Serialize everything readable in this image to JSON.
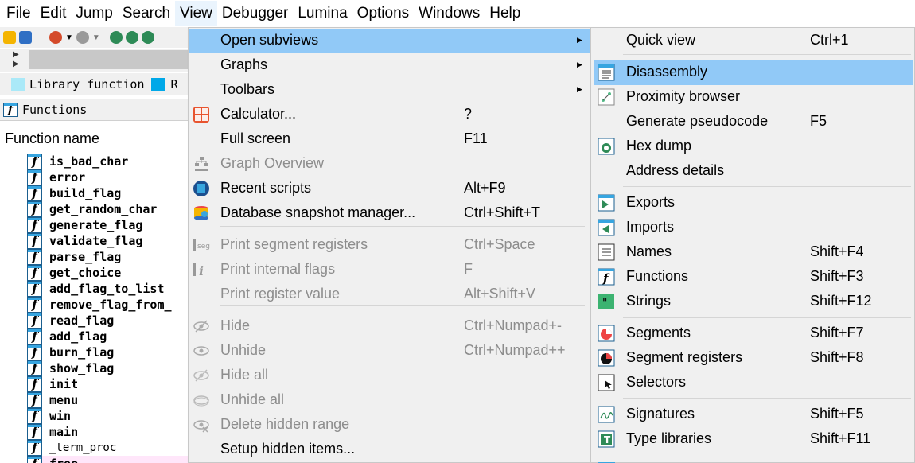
{
  "menubar": {
    "items": [
      "File",
      "Edit",
      "Jump",
      "Search",
      "View",
      "Debugger",
      "Lumina",
      "Options",
      "Windows",
      "Help"
    ],
    "active": "View"
  },
  "legend": {
    "library_function": "Library function",
    "truncated": "R"
  },
  "functions_window": {
    "title": "Functions",
    "column_header": "Function name",
    "items": [
      "is_bad_char",
      "error",
      "build_flag",
      "get_random_char",
      "generate_flag",
      "validate_flag",
      "parse_flag",
      "get_choice",
      "add_flag_to_list",
      "remove_flag_from_",
      "read_flag",
      "add_flag",
      "burn_flag",
      "show_flag",
      "init",
      "menu",
      "win",
      "main",
      "_term_proc",
      "free"
    ]
  },
  "view_menu": {
    "items": [
      {
        "label": "Open subviews",
        "shortcut": "",
        "submenu": true,
        "disabled": false,
        "selected": true,
        "icon": ""
      },
      {
        "label": "Graphs",
        "shortcut": "",
        "submenu": true,
        "disabled": false,
        "icon": ""
      },
      {
        "label": "Toolbars",
        "shortcut": "",
        "submenu": true,
        "disabled": false,
        "icon": ""
      },
      {
        "label": "Calculator...",
        "shortcut": "?",
        "disabled": false,
        "icon": "calculator-icon"
      },
      {
        "label": "Full screen",
        "shortcut": "F11",
        "disabled": false,
        "icon": ""
      },
      {
        "label": "Graph Overview",
        "shortcut": "",
        "disabled": true,
        "icon": "graph-overview-icon"
      },
      {
        "label": "Recent scripts",
        "shortcut": "Alt+F9",
        "disabled": false,
        "icon": "recent-scripts-icon"
      },
      {
        "label": "Database snapshot manager...",
        "shortcut": "Ctrl+Shift+T",
        "disabled": false,
        "icon": "database-snapshot-icon"
      },
      {
        "label": "Print segment registers",
        "shortcut": "Ctrl+Space",
        "disabled": true,
        "icon": "segment-registers-icon"
      },
      {
        "label": "Print internal flags",
        "shortcut": "F",
        "disabled": true,
        "icon": "internal-flags-icon"
      },
      {
        "label": "Print register value",
        "shortcut": "Alt+Shift+V",
        "disabled": true,
        "icon": ""
      },
      {
        "label": "Hide",
        "shortcut": "Ctrl+Numpad+-",
        "disabled": true,
        "icon": "hide-icon"
      },
      {
        "label": "Unhide",
        "shortcut": "Ctrl+Numpad++",
        "disabled": true,
        "icon": "unhide-icon"
      },
      {
        "label": "Hide all",
        "shortcut": "",
        "disabled": true,
        "icon": "hide-all-icon"
      },
      {
        "label": "Unhide all",
        "shortcut": "",
        "disabled": true,
        "icon": "unhide-all-icon"
      },
      {
        "label": "Delete hidden range",
        "shortcut": "",
        "disabled": true,
        "icon": "delete-hidden-range-icon"
      },
      {
        "label": "Setup hidden items...",
        "shortcut": "",
        "disabled": false,
        "icon": ""
      }
    ]
  },
  "subviews_menu": {
    "items": [
      {
        "label": "Quick view",
        "shortcut": "Ctrl+1",
        "icon": ""
      },
      {
        "label": "Disassembly",
        "shortcut": "",
        "icon": "disassembly-icon",
        "selected": true
      },
      {
        "label": "Proximity browser",
        "shortcut": "",
        "icon": "proximity-browser-icon"
      },
      {
        "label": "Generate pseudocode",
        "shortcut": "F5",
        "icon": ""
      },
      {
        "label": "Hex dump",
        "shortcut": "",
        "icon": "hex-dump-icon"
      },
      {
        "label": "Address details",
        "shortcut": "",
        "icon": ""
      },
      {
        "label": "Exports",
        "shortcut": "",
        "icon": "exports-icon"
      },
      {
        "label": "Imports",
        "shortcut": "",
        "icon": "imports-icon"
      },
      {
        "label": "Names",
        "shortcut": "Shift+F4",
        "icon": "names-icon"
      },
      {
        "label": "Functions",
        "shortcut": "Shift+F3",
        "icon": "functions-icon"
      },
      {
        "label": "Strings",
        "shortcut": "Shift+F12",
        "icon": "strings-icon"
      },
      {
        "label": "Segments",
        "shortcut": "Shift+F7",
        "icon": "segments-icon"
      },
      {
        "label": "Segment registers",
        "shortcut": "Shift+F8",
        "icon": "segment-registers-view-icon"
      },
      {
        "label": "Selectors",
        "shortcut": "",
        "icon": "selectors-icon"
      },
      {
        "label": "Signatures",
        "shortcut": "Shift+F5",
        "icon": "signatures-icon"
      },
      {
        "label": "Type libraries",
        "shortcut": "Shift+F11",
        "icon": "type-libraries-icon"
      }
    ]
  },
  "colors": {
    "menu_selected": "#91c9f7",
    "library_function": "#aae9f8",
    "regular_function": "#00a8e8",
    "disabled_text": "#8d8d8d"
  }
}
